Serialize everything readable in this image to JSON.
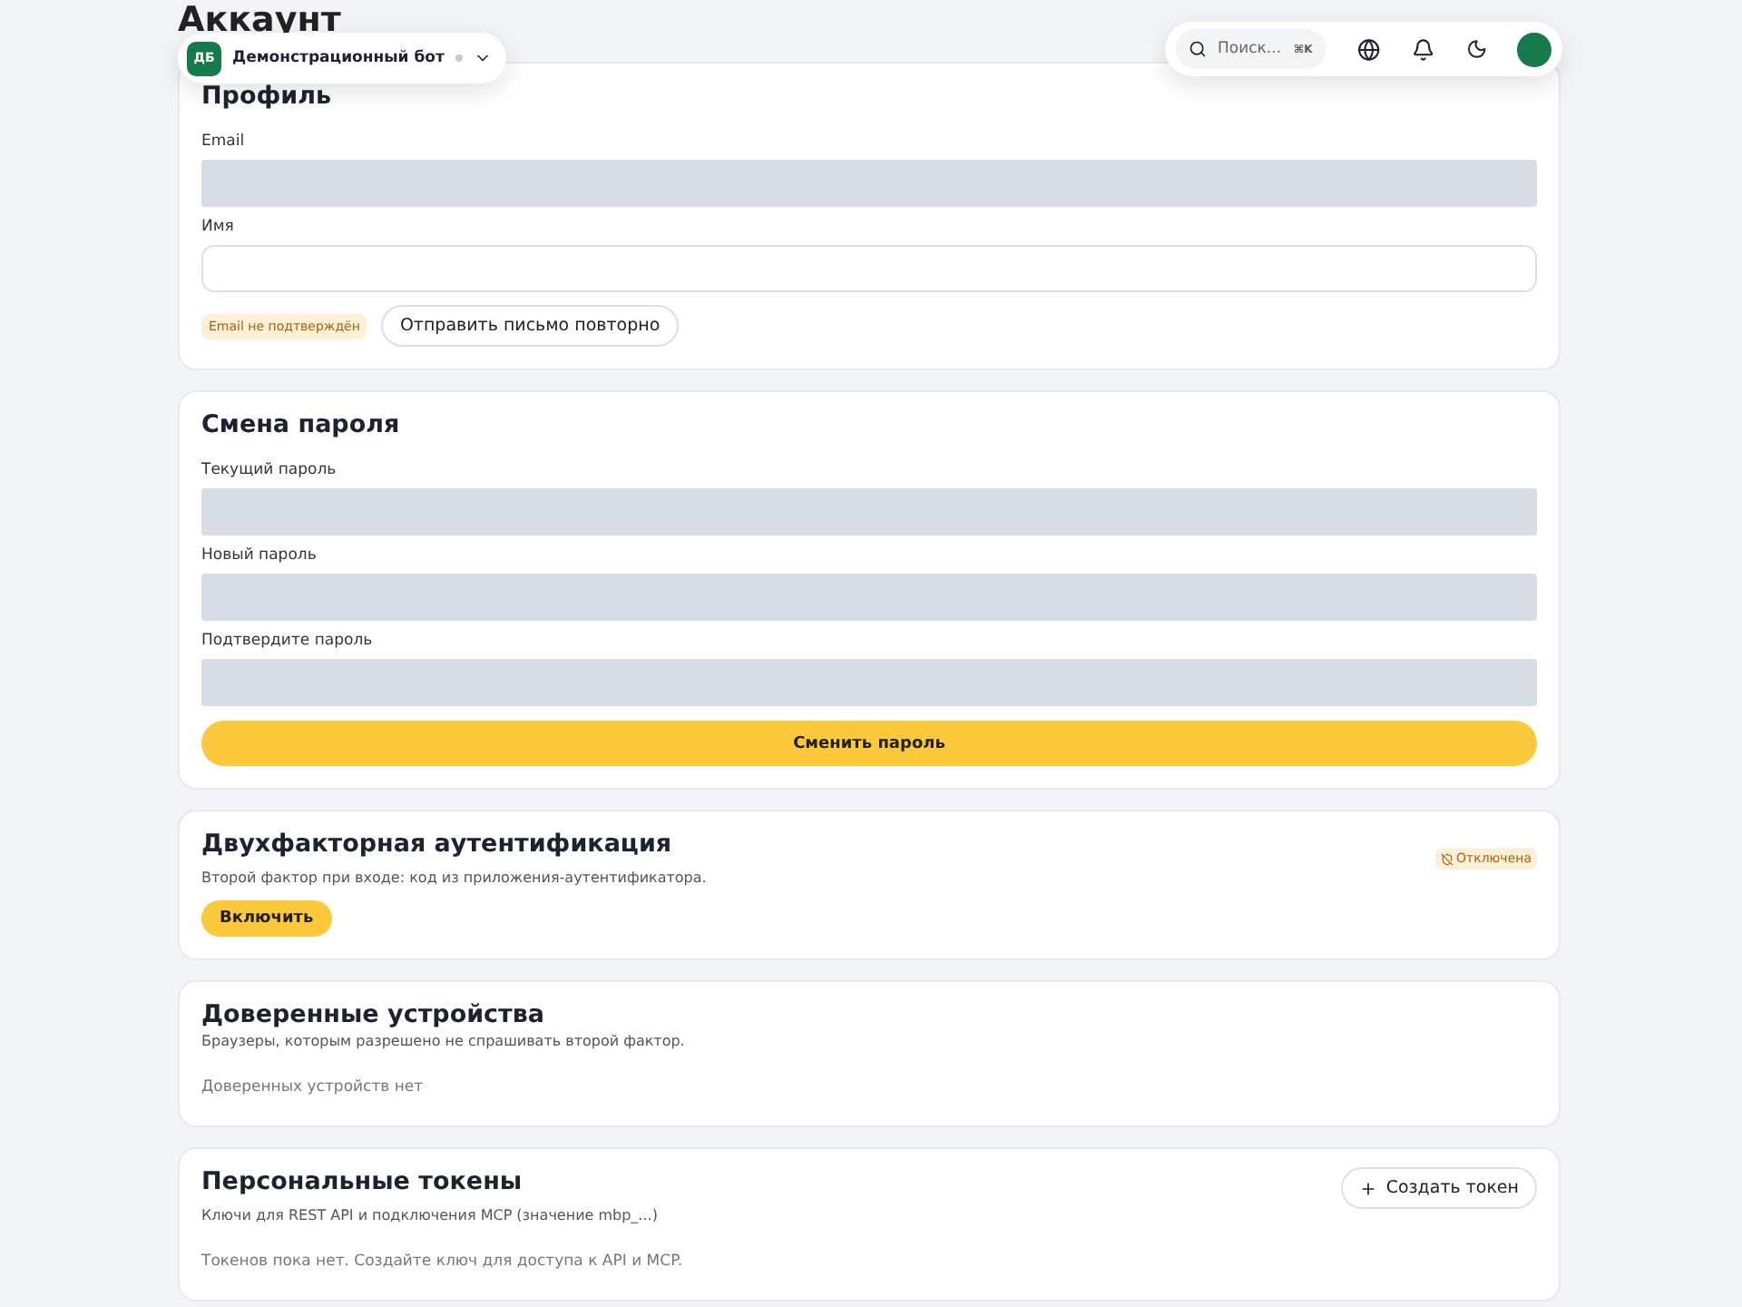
{
  "page_title": "Аккаунт",
  "workspace": {
    "initials": "ДБ",
    "name": "Демонстрационный бот"
  },
  "toolbar": {
    "search_placeholder": "Поиск...",
    "shortcut": "⌘K"
  },
  "profile": {
    "title": "Профиль",
    "fields": [
      {
        "label": "Email",
        "disabled": true
      },
      {
        "label": "Имя",
        "disabled": false
      }
    ],
    "badge": "Email не подтверждён",
    "resend_button": "Отправить письмо повторно"
  },
  "password": {
    "title": "Смена пароля",
    "fields": [
      {
        "label": "Текущий пароль",
        "disabled": true
      },
      {
        "label": "Новый пароль",
        "disabled": true
      },
      {
        "label": "Подтвердите пароль",
        "disabled": true
      }
    ],
    "submit_button": "Сменить пароль"
  },
  "two_factor": {
    "title": "Двухфакторная аутентификация",
    "subtitle": "Второй фактор при входе: код из приложения-аутентификатора.",
    "status": "Отключена",
    "enabled": false,
    "button": "Включить"
  },
  "devices": {
    "title": "Доверенные устройства",
    "subtitle": "Браузеры, которым разрешено не спрашивать второй фактор.",
    "empty": "Доверенных устройств нет"
  },
  "tokens": {
    "title": "Персональные токены",
    "subtitle": "Ключи для REST API и подключения MCP (значение mbp_...)",
    "button": "Создать токен",
    "empty": "Токенов пока нет. Создайте ключ для доступа к API и MCP."
  }
}
